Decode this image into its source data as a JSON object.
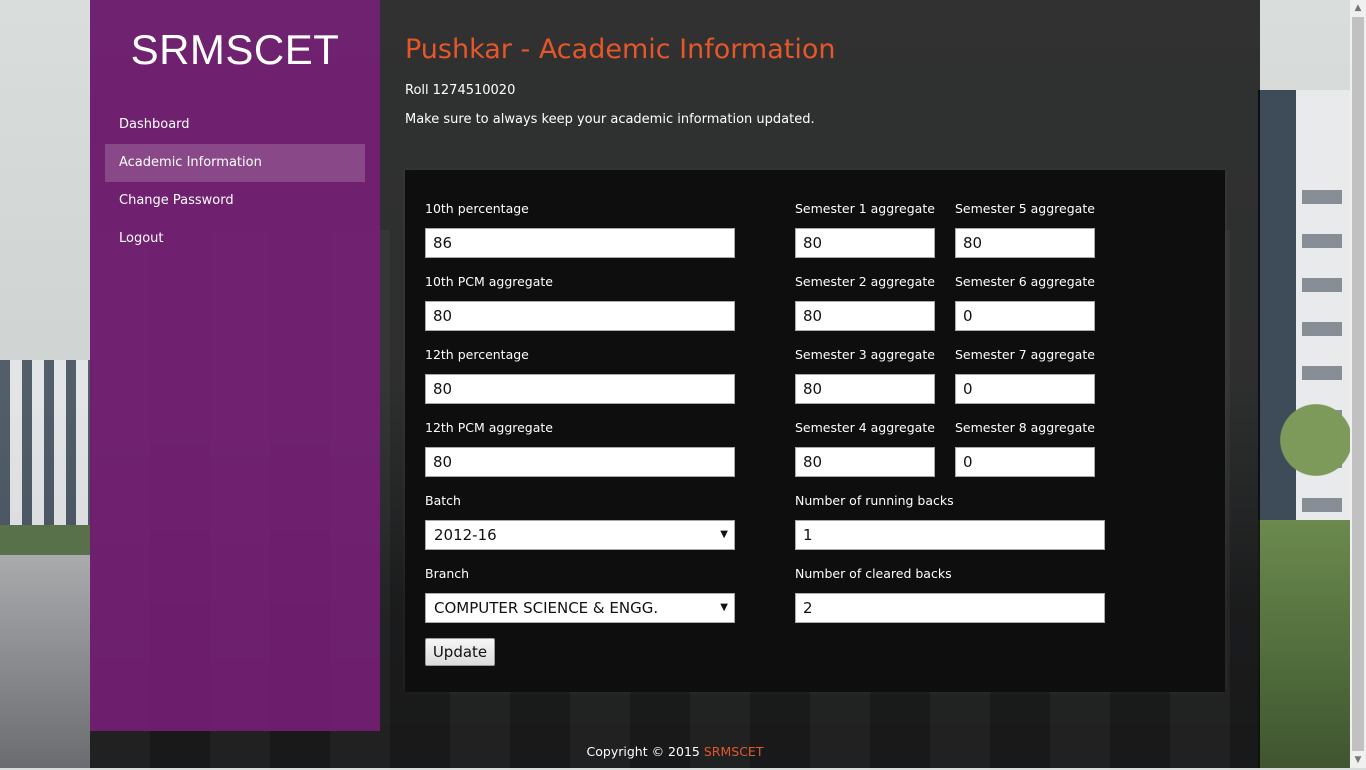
{
  "brand": "SRMSCET",
  "nav": [
    {
      "label": "Dashboard",
      "active": false
    },
    {
      "label": "Academic Information",
      "active": true
    },
    {
      "label": "Change Password",
      "active": false
    },
    {
      "label": "Logout",
      "active": false
    }
  ],
  "page": {
    "title": "Pushkar - Academic Information",
    "roll_label": "Roll",
    "roll_value": "1274510020",
    "hint": "Make sure to always keep your academic information updated."
  },
  "form": {
    "tenth_percentage": {
      "label": "10th percentage",
      "value": "86"
    },
    "tenth_pcm": {
      "label": "10th PCM aggregate",
      "value": "80"
    },
    "twelfth_percentage": {
      "label": "12th percentage",
      "value": "80"
    },
    "twelfth_pcm": {
      "label": "12th PCM aggregate",
      "value": "80"
    },
    "batch": {
      "label": "Batch",
      "value": "2012-16"
    },
    "branch": {
      "label": "Branch",
      "value": "COMPUTER SCIENCE & ENGG."
    },
    "sem1": {
      "label": "Semester 1 aggregate",
      "value": "80"
    },
    "sem2": {
      "label": "Semester 2 aggregate",
      "value": "80"
    },
    "sem3": {
      "label": "Semester 3 aggregate",
      "value": "80"
    },
    "sem4": {
      "label": "Semester 4 aggregate",
      "value": "80"
    },
    "sem5": {
      "label": "Semester 5 aggregate",
      "value": "80"
    },
    "sem6": {
      "label": "Semester 6 aggregate",
      "value": "0"
    },
    "sem7": {
      "label": "Semester 7 aggregate",
      "value": "0"
    },
    "sem8": {
      "label": "Semester 8 aggregate",
      "value": "0"
    },
    "running_backs": {
      "label": "Number of running backs",
      "value": "1"
    },
    "cleared_backs": {
      "label": "Number of cleared backs",
      "value": "2"
    },
    "submit_label": "Update"
  },
  "footer": {
    "copyright": "Copyright © 2015",
    "brand_link": "SRMSCET"
  },
  "colors": {
    "sidebar": "#7a1f7a",
    "accent": "#e5572a"
  }
}
